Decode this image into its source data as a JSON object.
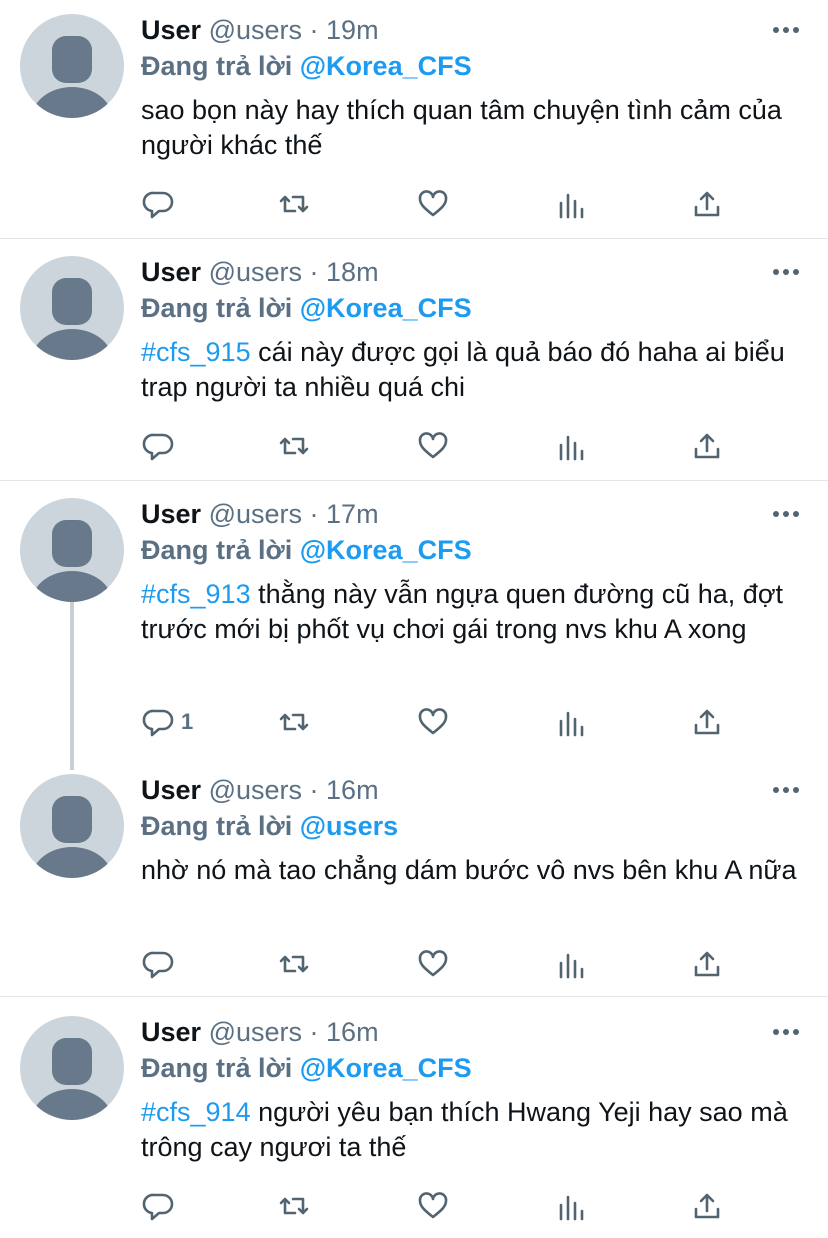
{
  "tweets": [
    {
      "name": "User",
      "handle": "@users",
      "dot": "·",
      "time": "19m",
      "replying_prefix": "Đang trả lời",
      "replying_to": "@Korea_CFS",
      "hashtag": "",
      "text": "sao bọn này hay thích quan tâm chuyện tình cảm của người khác thế",
      "reply_count": ""
    },
    {
      "name": "User",
      "handle": "@users",
      "dot": "·",
      "time": "18m",
      "replying_prefix": "Đang trả lời",
      "replying_to": "@Korea_CFS",
      "hashtag": "#cfs_915",
      "text": " cái này được gọi là quả báo đó haha ai biểu trap người ta nhiều quá chi",
      "reply_count": ""
    },
    {
      "name": "User",
      "handle": "@users",
      "dot": "·",
      "time": "17m",
      "replying_prefix": "Đang trả lời",
      "replying_to": "@Korea_CFS",
      "hashtag": "#cfs_913",
      "text": " thằng này vẫn ngựa quen đường cũ ha, đợt trước mới bị phốt vụ chơi gái trong nvs khu A xong",
      "reply_count": "1"
    },
    {
      "name": "User",
      "handle": "@users",
      "dot": "·",
      "time": "16m",
      "replying_prefix": "Đang trả lời",
      "replying_to": "@users",
      "hashtag": "",
      "text": "nhờ nó mà tao chẳng dám bước vô nvs bên khu A nữa",
      "reply_count": ""
    },
    {
      "name": "User",
      "handle": "@users",
      "dot": "·",
      "time": "16m",
      "replying_prefix": "Đang trả lời",
      "replying_to": "@Korea_CFS",
      "hashtag": "#cfs_914",
      "text": " người yêu bạn thích Hwang Yeji hay sao mà trông cay ngươi ta thế",
      "reply_count": ""
    }
  ],
  "icons": {
    "reply": "reply-icon",
    "retweet": "retweet-icon",
    "like": "heart-icon",
    "analytics": "analytics-icon",
    "share": "share-icon",
    "more": "more-icon"
  },
  "colors": {
    "accent": "#1d9bf0",
    "secondary": "#5b7083",
    "icon": "#536471",
    "divider": "#e1e5e8"
  }
}
